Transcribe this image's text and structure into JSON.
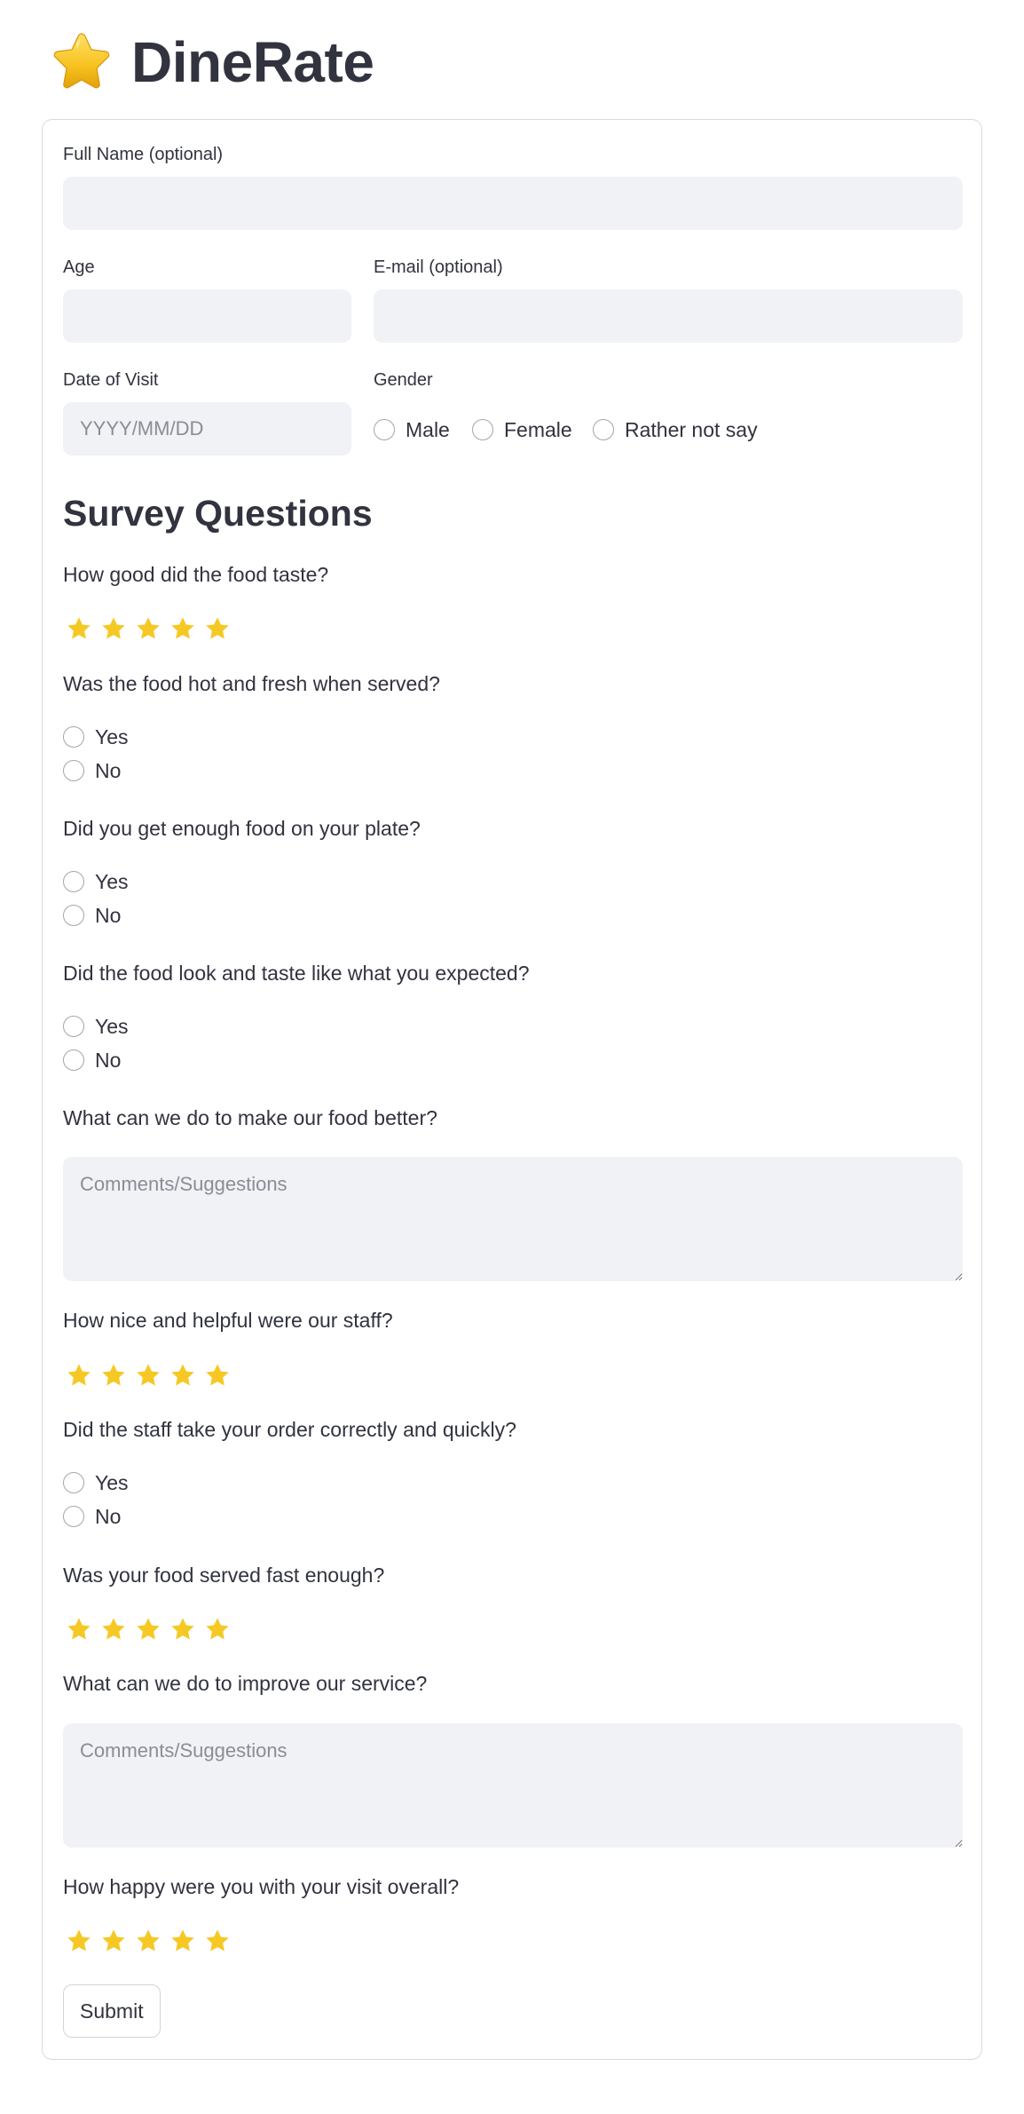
{
  "app": {
    "title": "DineRate",
    "logo_icon": "star-icon",
    "star_color": "#f6c823"
  },
  "personal": {
    "full_name_label": "Full Name (optional)",
    "full_name_value": "",
    "age_label": "Age",
    "age_value": "",
    "email_label": "E-mail (optional)",
    "email_value": "",
    "date_label": "Date of Visit",
    "date_placeholder": "YYYY/MM/DD",
    "gender_label": "Gender",
    "gender_options": [
      "Male",
      "Female",
      "Rather not say"
    ]
  },
  "survey": {
    "heading": "Survey Questions",
    "q_food_taste": {
      "text": "How good did the food taste?",
      "rating_max": 5
    },
    "q_food_hot": {
      "text": "Was the food hot and fresh when served?",
      "options": [
        "Yes",
        "No"
      ]
    },
    "q_food_portion": {
      "text": "Did you get enough food on your plate?",
      "options": [
        "Yes",
        "No"
      ]
    },
    "q_food_expected": {
      "text": "Did the food look and taste like what you expected?",
      "options": [
        "Yes",
        "No"
      ]
    },
    "q_food_improve": {
      "text": "What can we do to make our food better?",
      "placeholder": "Comments/Suggestions"
    },
    "q_staff_nice": {
      "text": "How nice and helpful were our staff?",
      "rating_max": 5
    },
    "q_staff_order": {
      "text": "Did the staff take your order correctly and quickly?",
      "options": [
        "Yes",
        "No"
      ]
    },
    "q_speed": {
      "text": "Was your food served fast enough?",
      "rating_max": 5
    },
    "q_service_improve": {
      "text": "What can we do to improve our service?",
      "placeholder": "Comments/Suggestions"
    },
    "q_overall": {
      "text": "How happy were you with your visit overall?",
      "rating_max": 5
    }
  },
  "actions": {
    "submit_label": "Submit"
  }
}
